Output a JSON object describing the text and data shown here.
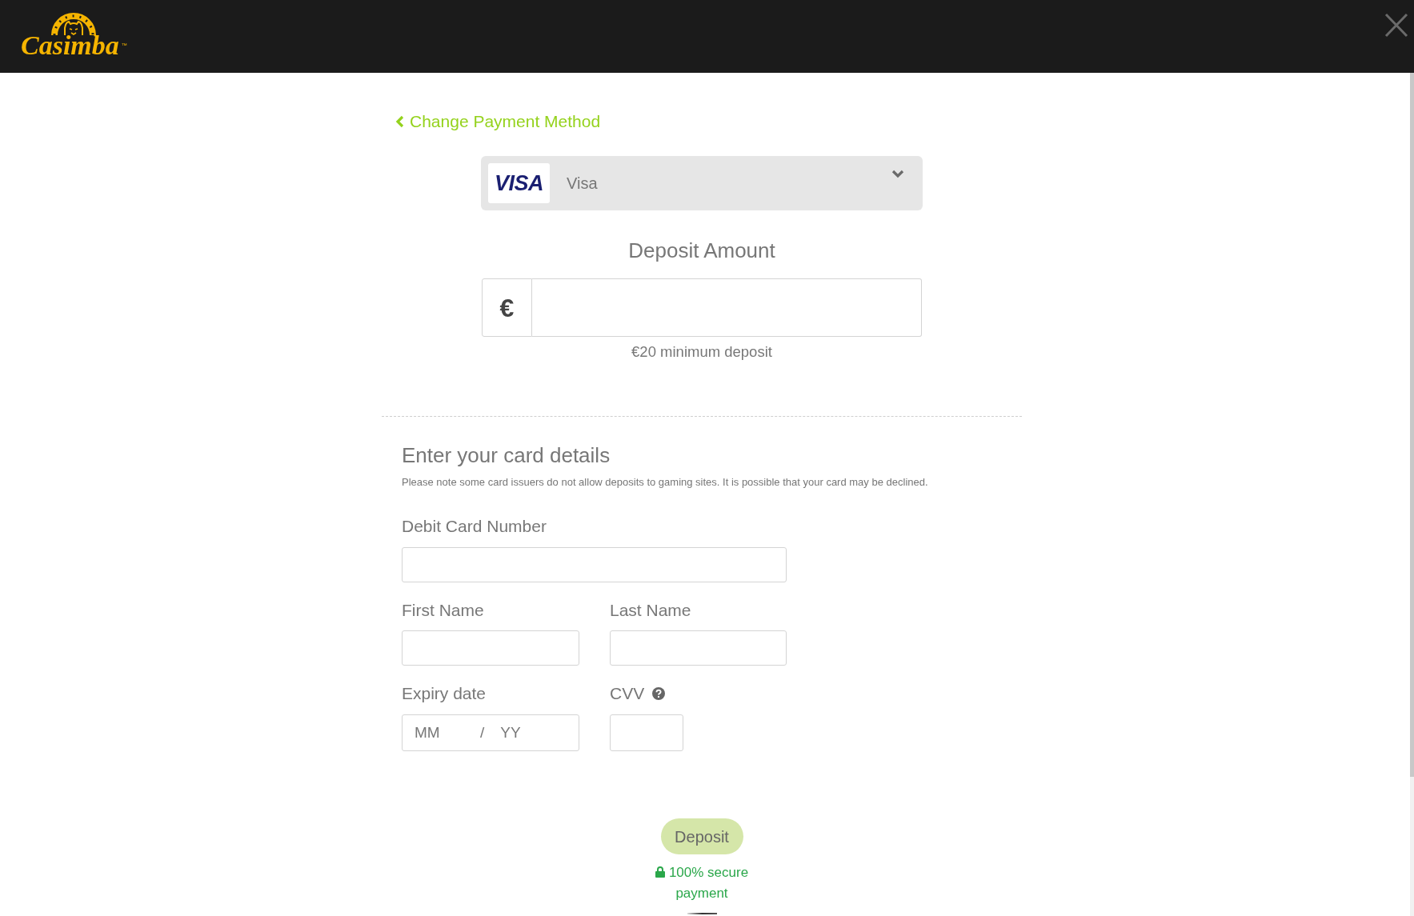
{
  "header": {
    "logo_text": "Casimba",
    "logo_trademark": "™"
  },
  "back_link": {
    "label": "Change Payment Method"
  },
  "payment_method": {
    "logo_text": "VISA",
    "label": "Visa",
    "expanded": false
  },
  "deposit_amount": {
    "title": "Deposit Amount",
    "currency_symbol": "€",
    "hint": "€20 minimum deposit"
  },
  "card_details": {
    "title": "Enter your card details",
    "note": "Please note some card issuers do not allow deposits to gaming sites. It is possible that your card may be declined.",
    "card_number": {
      "label": "Debit Card Number"
    },
    "first_name": {
      "label": "First Name"
    },
    "last_name": {
      "label": "Last Name"
    },
    "expiry_date": {
      "label": "Expiry date",
      "month_placeholder": "MM",
      "separator": "/",
      "year_placeholder": "YY"
    },
    "cvv": {
      "label": "CVV"
    }
  },
  "deposit_button": {
    "label": "Deposit",
    "disabled": true
  },
  "secure_note": "100% secure payment"
}
